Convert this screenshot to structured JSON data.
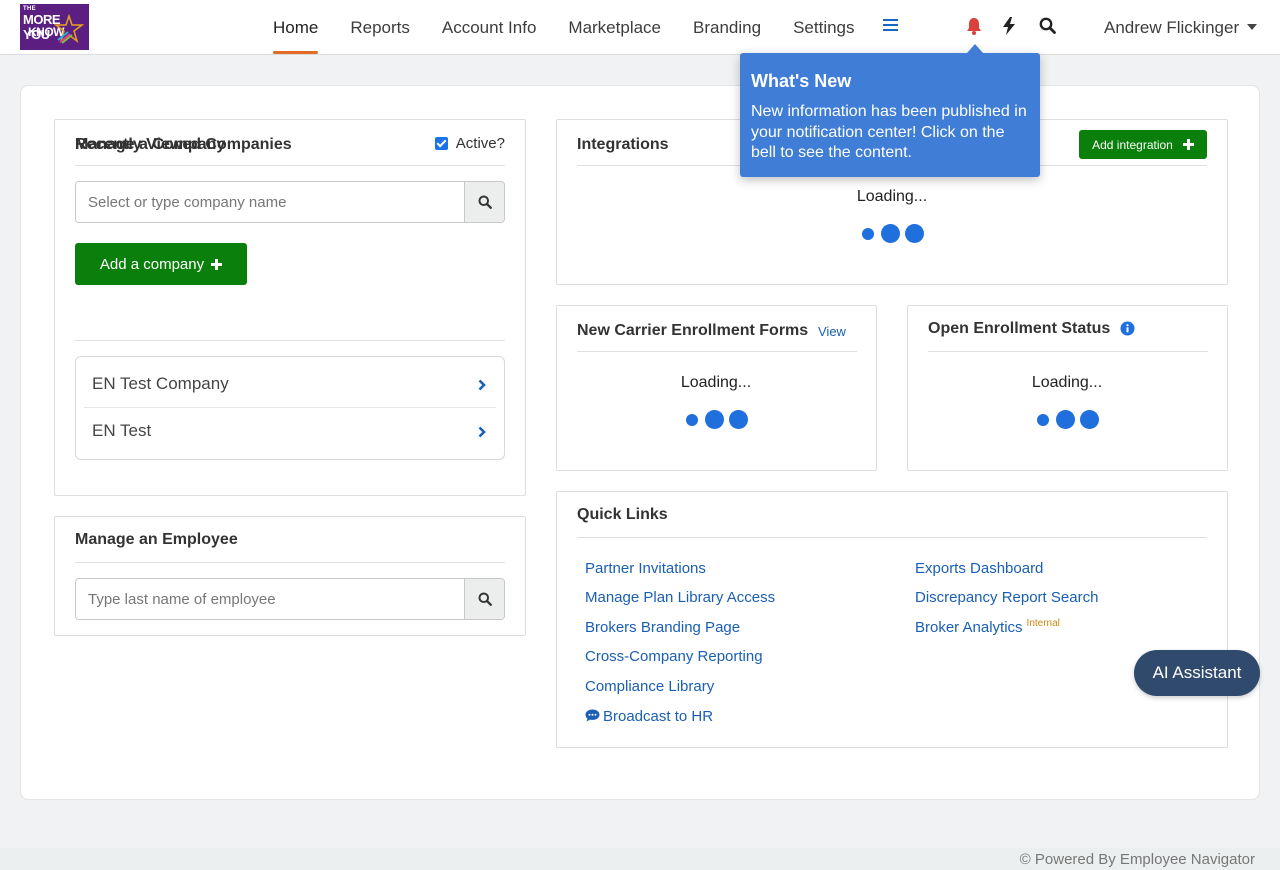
{
  "logo": {
    "line1": "THE",
    "line2": "MORE YOU",
    "line3": "KNOW"
  },
  "nav": {
    "items": [
      {
        "label": "Home",
        "active": true
      },
      {
        "label": "Reports"
      },
      {
        "label": "Account Info"
      },
      {
        "label": "Marketplace"
      },
      {
        "label": "Branding"
      },
      {
        "label": "Settings"
      }
    ],
    "icons": [
      "hamburger-icon",
      "bell-icon",
      "bolt-icon",
      "search-icon"
    ],
    "user": "Andrew Flickinger"
  },
  "tooltip": {
    "title": "What's New",
    "body": "New information has been published in your notification center! Click on the bell to see the content."
  },
  "company": {
    "title": "Manage a Company",
    "active_label": "Active?",
    "active_checked": true,
    "search_placeholder": "Select or type company name",
    "add_button": "Add a company",
    "recent_title": "Recently Viewed Companies",
    "recent": [
      "EN Test Company",
      "EN Test"
    ]
  },
  "employee": {
    "title": "Manage an Employee",
    "search_placeholder": "Type last name of employee"
  },
  "integrations": {
    "title": "Integrations",
    "add_button": "Add integration",
    "loading": "Loading..."
  },
  "carrier": {
    "title": "New Carrier Enrollment Forms",
    "view": "View",
    "loading": "Loading..."
  },
  "open_enrollment": {
    "title": "Open Enrollment Status",
    "loading": "Loading..."
  },
  "quick_links": {
    "title": "Quick Links",
    "left": [
      "Partner Invitations",
      "Manage Plan Library Access",
      "Brokers Branding Page",
      "Cross-Company Reporting",
      "Compliance Library",
      "Broadcast to HR"
    ],
    "right": [
      "Exports Dashboard",
      "Discrepancy Report Search",
      "Broker Analytics"
    ],
    "internal_badge": "Internal"
  },
  "ai_assistant": "AI Assistant",
  "footer": "© Powered By Employee Navigator",
  "colors": {
    "primary_blue": "#1f6fdc",
    "green": "#0b7f0b",
    "nav_active": "#e26b25",
    "tooltip": "#3f7dd6",
    "bell": "#d9413a",
    "ai_button": "#2f4a6d"
  }
}
